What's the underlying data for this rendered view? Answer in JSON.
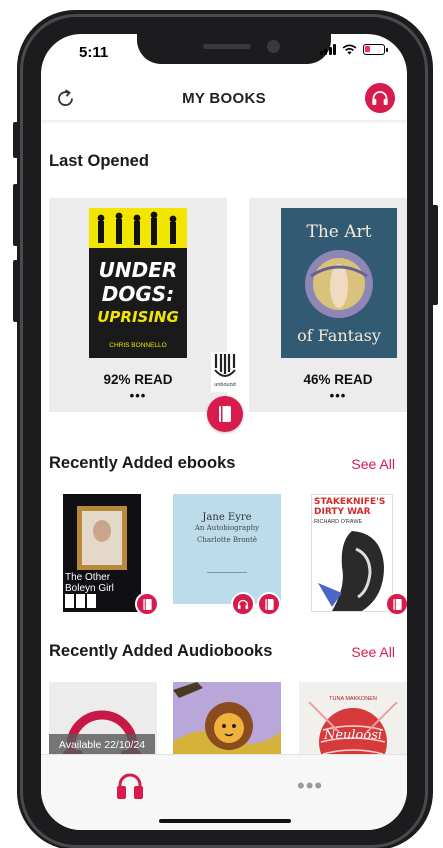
{
  "status_bar": {
    "time": "5:11"
  },
  "header": {
    "title": "MY BOOKS"
  },
  "last_opened": {
    "title": "Last Opened",
    "books": [
      {
        "cover_top": "UNDER",
        "cover_mid": "DOGS:",
        "cover_bottom": "UPRISING",
        "author": "CHRIS BONNELLO",
        "progress": "92% READ",
        "more": "•••"
      },
      {
        "cover_line1": "The Art",
        "cover_line2": "of Fantasy",
        "progress": "46% READ",
        "more": "•••"
      }
    ],
    "publisher_logo_text": "unbound"
  },
  "ebooks": {
    "title": "Recently Added ebooks",
    "see_all": "See All",
    "books": [
      {
        "cover_title": "The Other Boleyn Girl"
      },
      {
        "cover_title": "Jane Eyre",
        "cover_subtitle": "An Autobiography",
        "cover_author": "Charlotte Brontë"
      },
      {
        "cover_title": "STAKEKNIFE'S DIRTY WAR",
        "cover_author": "RICHARD O'RAWE"
      }
    ]
  },
  "audiobooks": {
    "title": "Recently Added Audiobooks",
    "see_all": "See All",
    "availability": "Available 22/10/24",
    "books": [
      {
        "cover_title": ""
      },
      {
        "cover_title": ""
      },
      {
        "cover_author": "TUNA MAKKONEN",
        "cover_title": "Neuloosi"
      }
    ]
  },
  "tabbar": {
    "more": "•••"
  },
  "colors": {
    "accent": "#d81b4d"
  }
}
